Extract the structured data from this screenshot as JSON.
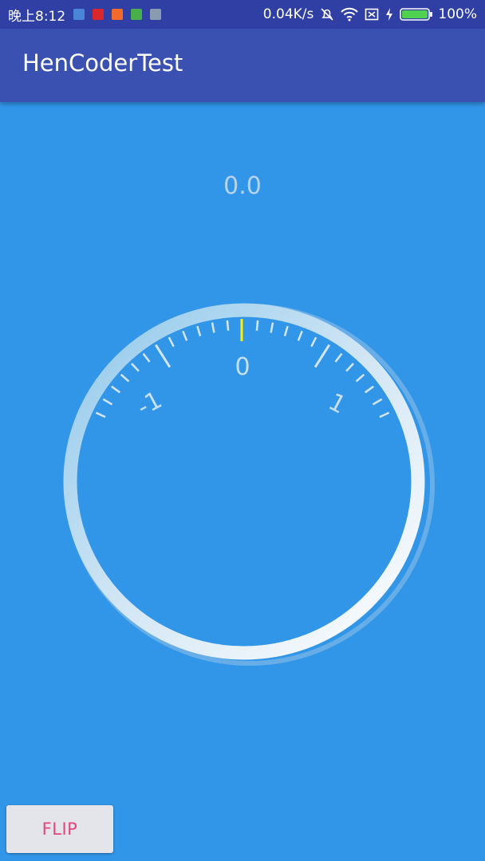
{
  "status_bar": {
    "time": "晚上8:12",
    "network_speed": "0.04K/s",
    "battery": "100%",
    "notification_icons": [
      "usb-icon",
      "news-app-icon",
      "video-app-icon",
      "wechat-icon",
      "message-icon"
    ],
    "status_icons": [
      "mute-icon",
      "wifi-icon",
      "no-sim-icon",
      "charging-icon",
      "battery-icon"
    ]
  },
  "app_bar": {
    "title": "HenCoderTest"
  },
  "main": {
    "value_label": "0.0",
    "dial": {
      "labels": [
        "0",
        "-1",
        "1"
      ],
      "indicator_color": "#ffee00"
    }
  },
  "flip_button": {
    "label": "FLIP"
  },
  "colors": {
    "status_bar": "#2f3fa4",
    "app_bar": "#3a51b2",
    "background": "#3296e8",
    "button_text": "#e2467a"
  }
}
